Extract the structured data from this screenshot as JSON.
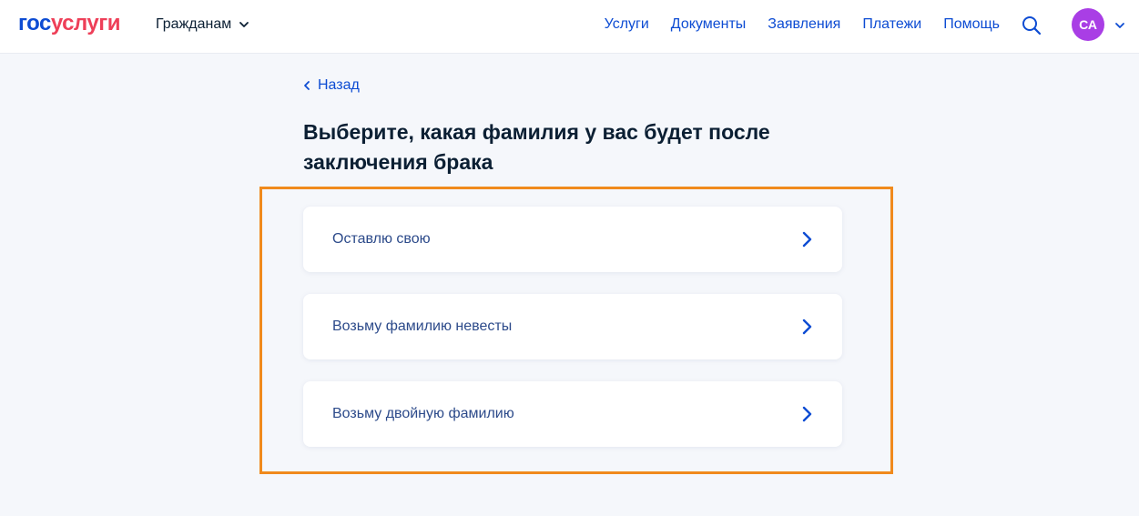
{
  "header": {
    "logo_part1": "гос",
    "logo_part2": "услуги",
    "audience": "Гражданам",
    "nav": [
      "Услуги",
      "Документы",
      "Заявления",
      "Платежи",
      "Помощь"
    ],
    "avatar_initials": "СА"
  },
  "page": {
    "back_label": "Назад",
    "title": "Выберите, какая фамилия у вас будет после заключения брака",
    "options": [
      "Оставлю свою",
      "Возьму фамилию невесты",
      "Возьму двойную фамилию"
    ]
  },
  "colors": {
    "brand_blue": "#0d4cd3",
    "brand_red": "#ee3f58",
    "avatar": "#a93ee5",
    "highlight": "#f08a1c"
  }
}
